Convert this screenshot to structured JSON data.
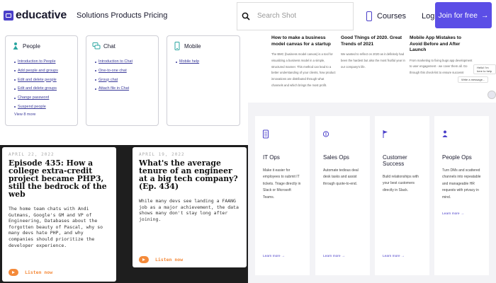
{
  "educative": {
    "brand": "educative",
    "nav_links": "Solutions Products Pricing",
    "cards": [
      {
        "title": "People",
        "links": [
          "Introduction to People",
          "Add people and groups",
          "Edit and delete people",
          "Edit and delete groups",
          "Change password",
          "Suspend people"
        ],
        "view_more": "View 8 more"
      },
      {
        "title": "Chat",
        "links": [
          "Introduction to Chat",
          "One-to-one chat",
          "Group chat",
          "Attach file in Chat"
        ]
      },
      {
        "title": "Mobile",
        "links": [
          "Mobile help"
        ]
      }
    ]
  },
  "podcast": {
    "episodes": [
      {
        "date": "APRIL 22, 2022",
        "title": "Episode 435: How a college extra-credit project became PHP3, still the bedrock of the web",
        "description": "The home team chats with Andi Gutmans, Google's GM and VP of Engineering, Databases about the forgotten beauty of Pascal, why so many devs hate PHP, and why companies should prioritize the developer experience.",
        "listen": "Listen now"
      },
      {
        "date": "APRIL 19, 2022",
        "title": "What's the average tenure of an engineer at a big tech company? (Ep. 434)",
        "description": "While many devs see landing a FAANG job as a major achievement, the data shows many don't stay long after joining.",
        "listen": "Listen now"
      }
    ]
  },
  "site_header": {
    "search_placeholder": "Search Shot",
    "courses": "Courses",
    "login": "Log In",
    "join": "Join for free",
    "join_arrow": "→"
  },
  "blog": {
    "articles": [
      {
        "title": "How to make a business model canvas for a startup",
        "description": "The BMC (business model canvas) is a tool for visualizing a business model in a simple, structured manner. This method can lead to a better understanding of your clients, how product innovations are distributed through what channels and which brings the most profit."
      },
      {
        "title": "Good Things of 2020. Great Trends of 2021",
        "description": "We wanted to reflect on 2020 as it definitely had been the hardest but also the most fruitful year in our company's life."
      },
      {
        "title": "Mobile App Mistakes to Avoid Before and After Launch",
        "description": "From marketing to fixing bugs app development to user engagement - we cover them all. Go through this check-list to ensure success!"
      }
    ],
    "chat_bubbles": [
      "Hello! I'm here to help",
      "Write a message..."
    ]
  },
  "ops": {
    "cards": [
      {
        "title": "IT Ops",
        "description": "Make it easier for employees to submit IT tickets. Triage directly in Slack or Microsoft Teams.",
        "learn": "Learn more →"
      },
      {
        "title": "Sales Ops",
        "description": "Automate tedious deal desk tasks and assist through quote-to-end.",
        "learn": "Learn more →"
      },
      {
        "title": "Customer Success",
        "description": "Build relationships with your best customers directly in Slack.",
        "learn": "Learn more →"
      },
      {
        "title": "People Ops",
        "description": "Turn DMs and scattered channels into repeatable and manageable HR requests with privacy in mind.",
        "learn": "Learn more →"
      }
    ],
    "accent": "#4a3fc9"
  }
}
